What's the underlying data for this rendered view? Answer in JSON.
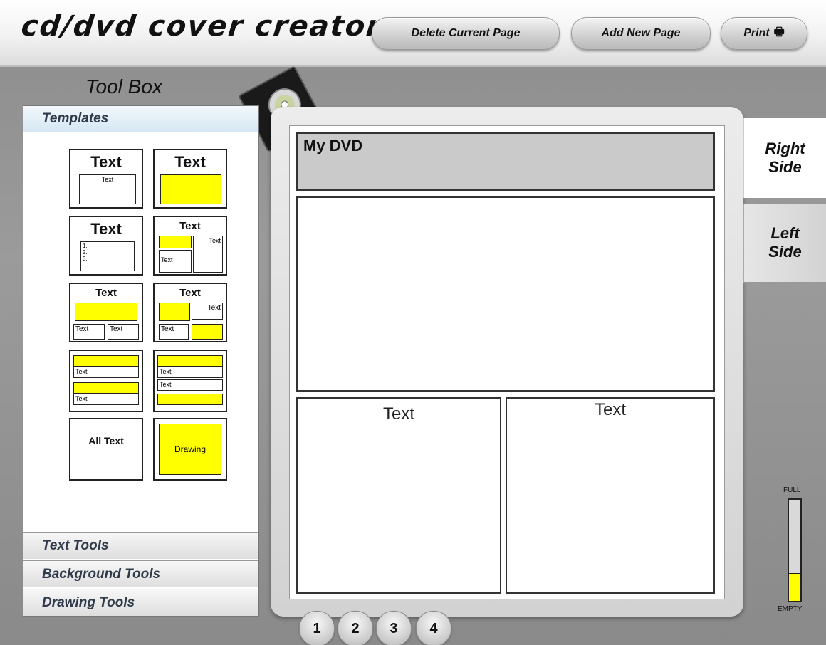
{
  "header": {
    "title": "cd/dvd cover creator",
    "buttons": {
      "delete": "Delete Current Page",
      "add": "Add New Page",
      "print": "Print"
    },
    "print_icon": "printer-icon"
  },
  "toolbox": {
    "title": "Tool Box",
    "active_section": "Templates",
    "sections": [
      "Text Tools",
      "Background Tools",
      "Drawing Tools"
    ],
    "templates": [
      {
        "big": "Text",
        "small": "Text"
      },
      {
        "big": "Text"
      },
      {
        "big": "Text",
        "list": [
          "1.",
          "2.",
          "3."
        ]
      },
      {
        "big": "Text",
        "a": "Text",
        "b": "Text"
      },
      {
        "big": "Text",
        "a": "Text",
        "b": "Text"
      },
      {
        "big": "Text",
        "a": "Text",
        "b": "Text"
      },
      {
        "a": "Text",
        "b": "Text"
      },
      {
        "a": "Text",
        "b": "Text"
      },
      {
        "label": "All Text"
      },
      {
        "label": "Drawing"
      }
    ]
  },
  "page": {
    "title_text": "My DVD",
    "left_text": "Text",
    "right_text": "Text"
  },
  "side_tabs": {
    "right": "Right Side",
    "left": "Left Side"
  },
  "meter": {
    "full_label": "FULL",
    "empty_label": "EMPTY",
    "level": 0.27,
    "fill_color": "#ffff00"
  },
  "pages": [
    "1",
    "2",
    "3",
    "4"
  ],
  "colors": {
    "accent_yellow": "#ffff00",
    "title_bar_gray": "#cacaca"
  }
}
